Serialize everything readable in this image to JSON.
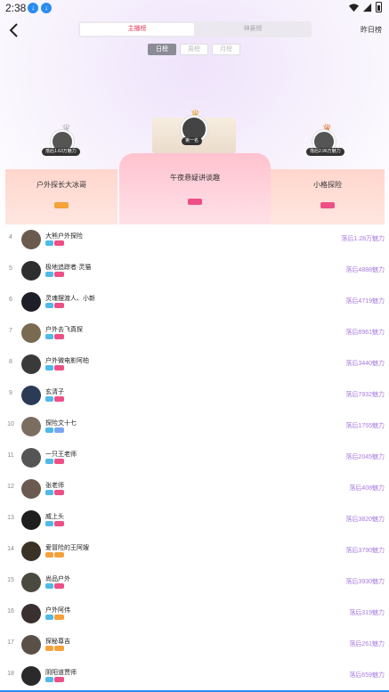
{
  "status_bar": {
    "time": "2:38"
  },
  "header": {
    "tabs": [
      "主播榜",
      "神豪榜"
    ],
    "yesterday_label": "昨日榜"
  },
  "period_tabs": [
    "日榜",
    "周榜",
    "月榜"
  ],
  "podium": {
    "first": {
      "name": "午夜悬疑讲谈趣",
      "badge": "第一名"
    },
    "second": {
      "name": "户外探长大冰哥",
      "gap_badge": "落后1.63万魅力"
    },
    "third": {
      "name": "小格探险",
      "gap_badge": "落后2.96万魅力"
    }
  },
  "list": [
    {
      "rank": "4",
      "name": "大熊户外探险",
      "gap": "落后1.28万魅力"
    },
    {
      "rank": "5",
      "name": "极地追踪者·灵猫",
      "gap": "落后4888魅力"
    },
    {
      "rank": "6",
      "name": "灵魂摆渡人、小新",
      "gap": "落后4719魅力"
    },
    {
      "rank": "7",
      "name": "户外去飞真探",
      "gap": "落后8961魅力"
    },
    {
      "rank": "8",
      "name": "户外微电影阿柏",
      "gap": "落后3440魅力"
    },
    {
      "rank": "9",
      "name": "玄清子",
      "gap": "落后7932魅力"
    },
    {
      "rank": "10",
      "name": "探险文十七",
      "gap": "落后1755魅力"
    },
    {
      "rank": "11",
      "name": "一只王老师",
      "gap": "落后2045魅力"
    },
    {
      "rank": "12",
      "name": "张老师",
      "gap": "落后408魅力"
    },
    {
      "rank": "13",
      "name": "威上头",
      "gap": "落后3820魅力"
    },
    {
      "rank": "14",
      "name": "爱冒险的王阿嫂",
      "gap": "落后3790魅力"
    },
    {
      "rank": "15",
      "name": "尚品户外",
      "gap": "落后3930魅力"
    },
    {
      "rank": "16",
      "name": "户外阿伟",
      "gap": "落后319魅力"
    },
    {
      "rank": "17",
      "name": "探秘尊吉",
      "gap": "落后261魅力"
    },
    {
      "rank": "18",
      "name": "阴阳道贾师",
      "gap": "落后659魅力"
    }
  ],
  "colors": {
    "accent_red": "#e23a5a",
    "gap_purple": "#a77ae0",
    "tag_blue": "#4fb9e8",
    "tag_pink": "#ee4f86"
  }
}
